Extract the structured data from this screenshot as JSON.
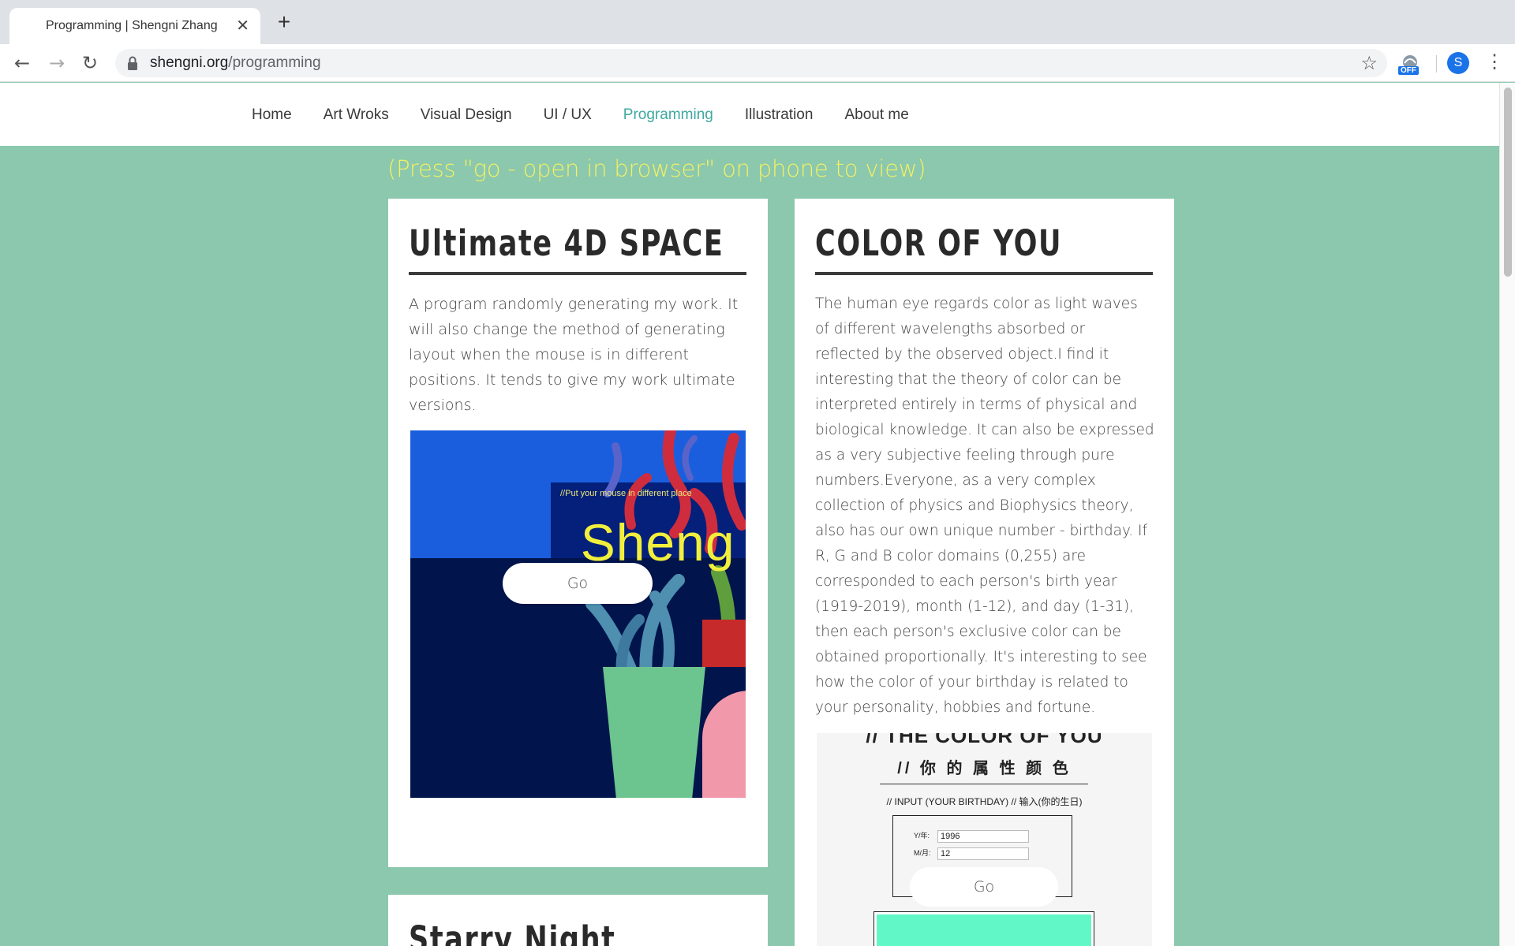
{
  "browser": {
    "tab_title": "Programming | Shengni Zhang",
    "tab_close": "✕",
    "new_tab": "+",
    "url_domain": "shengni.org",
    "url_path": "/programming",
    "ext_badge": "OFF",
    "profile_initial": "S"
  },
  "nav": {
    "items": [
      "Home",
      "Art Wroks",
      "Visual Design",
      "UI / UX",
      "Programming",
      "Illustration",
      "About me"
    ],
    "active": "Programming",
    "active_color": "#3fa9a0"
  },
  "notice": "(Press \"go - open in browser\" on phone to view)",
  "colors": {
    "page_bg": "#8bc8ad",
    "notice": "#f4f163",
    "swatch": "#62f7c7"
  },
  "cards": [
    {
      "title": "Ultimate 4D SPACE",
      "description": "A program randomly generating my work. It will also change the method of generating layout when the mouse is in different positions. It tends to give my work ultimate versions.",
      "preview": {
        "hint": "//Put your mouse in different place",
        "name": "_Sheng",
        "go_label": "Go"
      }
    },
    {
      "title": "COLOR OF YOU",
      "description": "The human eye regards color as light waves of different wavelengths absorbed or reflected by the observed object.I find it interesting that the theory of color can be interpreted entirely in terms of physical and biological knowledge. It can also be expressed as a very subjective feeling through pure numbers.Everyone, as a very complex collection of physics and Biophysics theory, also has our own unique number - birthday. If R, G and B color domains (0,255) are corresponded to each person's birth year (1919-2019), month (1-12), and day (1-31), then each person's exclusive color can be obtained proportionally. It's interesting to see how the color of your birthday is related to your personality, hobbies and fortune.",
      "preview": {
        "title": "// THE COLOR OF YOU",
        "subtitle": "// 你 的 属 性 颜 色",
        "input_label": "// INPUT (YOUR BIRTHDAY) // 输入(你的生日)",
        "year_label": "Y/年:",
        "year_value": "1996",
        "month_label": "M/月:",
        "month_value": "12",
        "go_label": "Go"
      }
    },
    {
      "title": "Starry Night"
    }
  ]
}
